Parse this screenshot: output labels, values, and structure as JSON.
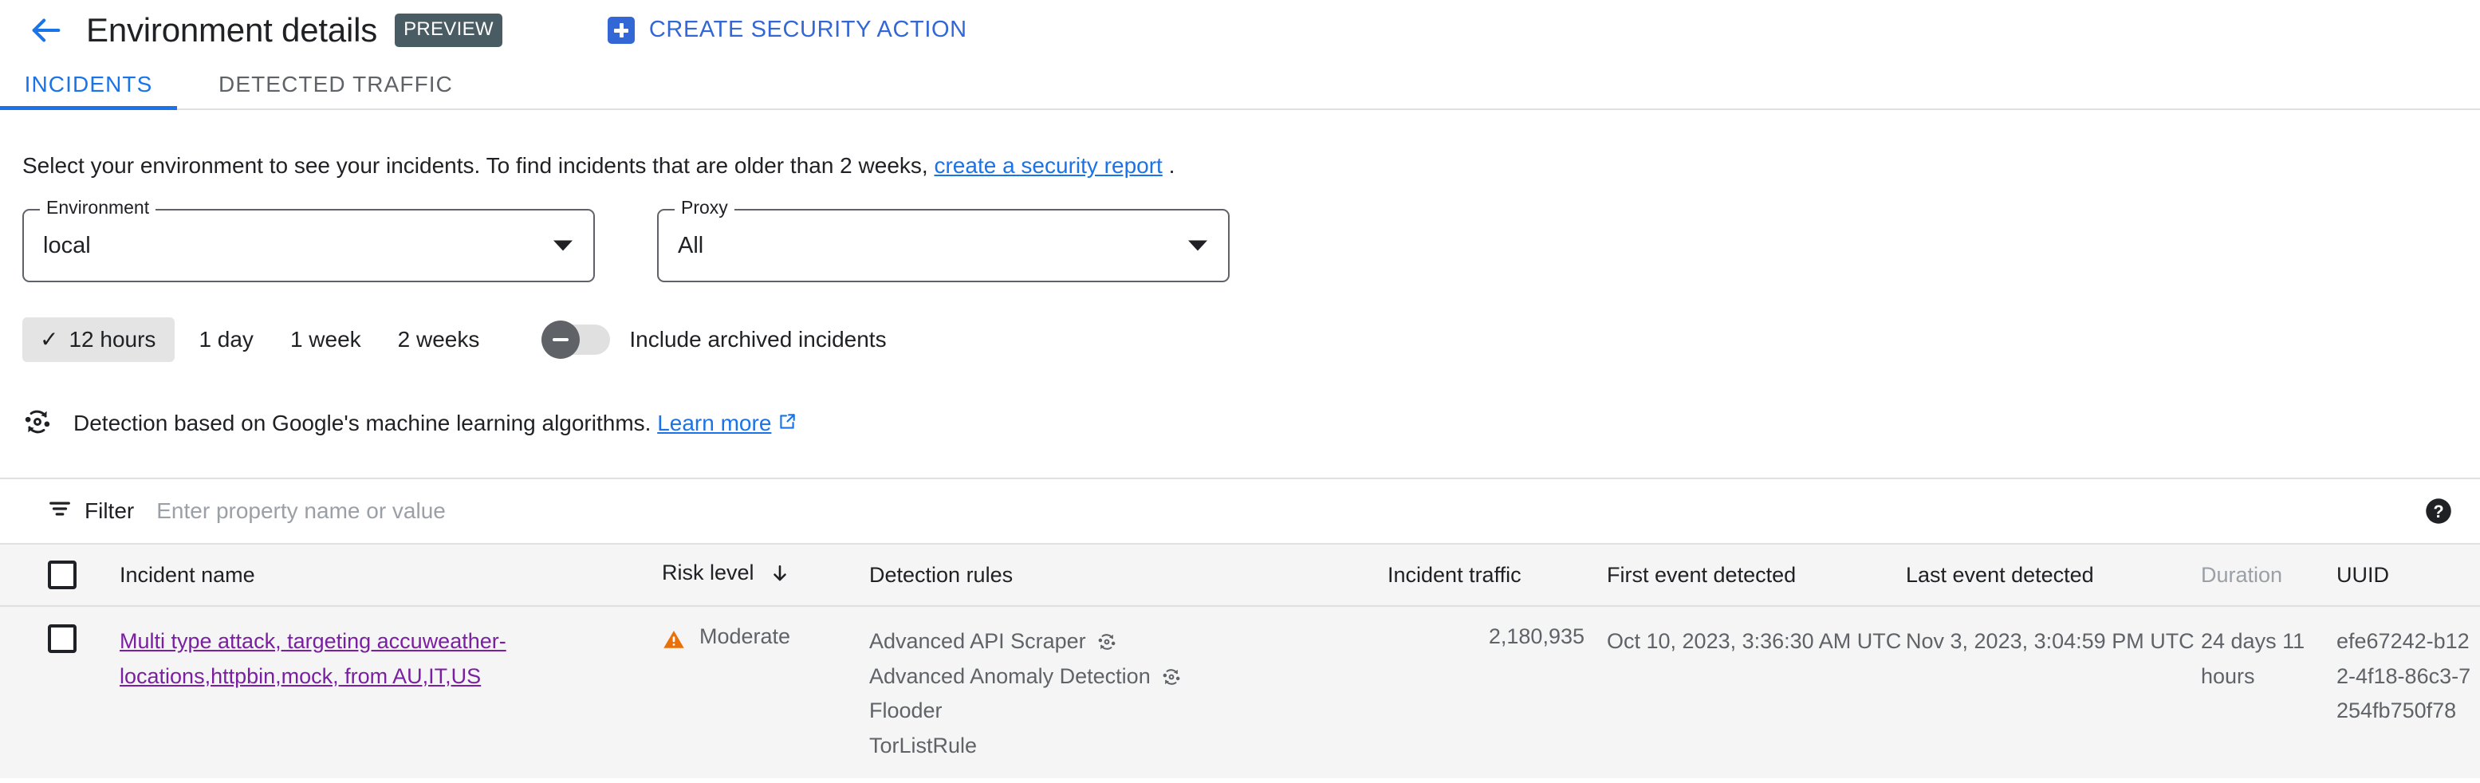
{
  "header": {
    "back_icon": "arrow-left-icon",
    "title": "Environment details",
    "preview_badge": "PREVIEW",
    "create_action_label": "CREATE SECURITY ACTION",
    "create_action_icon": "plus-box-icon",
    "accent_blue": "#3367d6"
  },
  "tabs": [
    {
      "label": "INCIDENTS",
      "active": true
    },
    {
      "label": "DETECTED TRAFFIC",
      "active": false
    }
  ],
  "intro": {
    "text_before": "Select your environment to see your incidents. To find incidents that are older than 2 weeks,",
    "link_text": "create a security report",
    "text_after": "."
  },
  "filters": {
    "environment": {
      "legend": "Environment",
      "value": "local",
      "caret_icon": "chevron-down-icon"
    },
    "proxy": {
      "legend": "Proxy",
      "value": "All",
      "caret_icon": "chevron-down-icon"
    }
  },
  "time_range": {
    "check_icon": "check-icon",
    "options": [
      {
        "label": "12 hours",
        "selected": true
      },
      {
        "label": "1 day",
        "selected": false
      },
      {
        "label": "1 week",
        "selected": false
      },
      {
        "label": "2 weeks",
        "selected": false
      }
    ],
    "toggle": {
      "label": "Include archived incidents",
      "on": false
    }
  },
  "ml_note": {
    "icon": "machine-learning-icon",
    "text": "Detection based on Google's machine learning algorithms.",
    "link_text": "Learn more",
    "link_icon": "external-link-icon"
  },
  "filter_bar": {
    "icon": "filter-icon",
    "label": "Filter",
    "placeholder": "Enter property name or value",
    "value": "",
    "help_icon": "help-circle-icon"
  },
  "table": {
    "columns": [
      {
        "key": "checkbox",
        "label": ""
      },
      {
        "key": "name",
        "label": "Incident name"
      },
      {
        "key": "risk",
        "label": "Risk level",
        "sort_icon": "arrow-down-icon"
      },
      {
        "key": "rules",
        "label": "Detection rules"
      },
      {
        "key": "traffic",
        "label": "Incident traffic"
      },
      {
        "key": "first",
        "label": "First event detected"
      },
      {
        "key": "last",
        "label": "Last event detected"
      },
      {
        "key": "duration",
        "label": "Duration",
        "dim": true
      },
      {
        "key": "uuid",
        "label": "UUID"
      }
    ],
    "rows": [
      {
        "name": "Multi type attack, targeting accuweather-locations,httpbin,mock, from AU,IT,US",
        "risk_level": "Moderate",
        "risk_icon": "warning-triangle-icon",
        "risk_color": "#e8710a",
        "rules": [
          {
            "name": "Advanced API Scraper",
            "ml": true
          },
          {
            "name": "Advanced Anomaly Detection",
            "ml": true
          },
          {
            "name": "Flooder",
            "ml": false
          },
          {
            "name": "TorListRule",
            "ml": false
          }
        ],
        "incident_traffic": "2,180,935",
        "first_event_detected": "Oct 10, 2023, 3:36:30 AM UTC",
        "last_event_detected": "Nov 3, 2023, 3:04:59 PM UTC",
        "duration": "24 days 11 hours",
        "uuid": "efe67242-b122-4f18-86c3-7254fb750f78"
      }
    ]
  }
}
